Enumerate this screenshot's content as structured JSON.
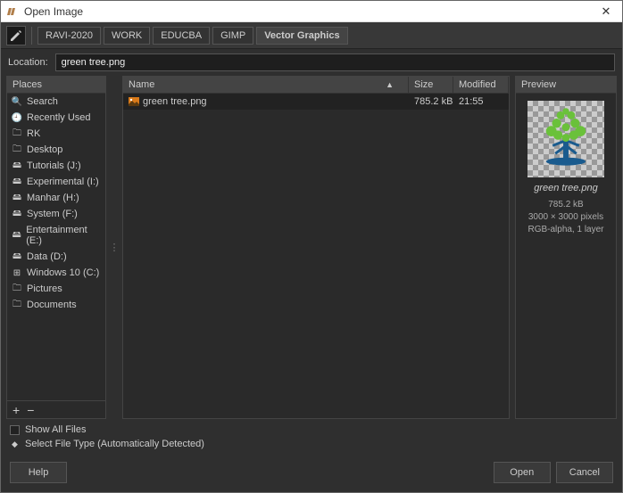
{
  "titlebar": {
    "title": "Open Image"
  },
  "breadcrumbs": [
    "RAVI-2020",
    "WORK",
    "EDUCBA",
    "GIMP",
    "Vector Graphics"
  ],
  "location": {
    "label": "Location:",
    "value": "green tree.png"
  },
  "places": {
    "header": "Places",
    "items": [
      {
        "icon": "search-icon",
        "label": "Search"
      },
      {
        "icon": "clock-icon",
        "label": "Recently Used"
      },
      {
        "icon": "folder-icon",
        "label": "RK"
      },
      {
        "icon": "folder-icon",
        "label": "Desktop"
      },
      {
        "icon": "drive-icon",
        "label": "Tutorials (J:)"
      },
      {
        "icon": "drive-icon",
        "label": "Experimental (I:)"
      },
      {
        "icon": "drive-icon",
        "label": "Manhar (H:)"
      },
      {
        "icon": "drive-icon",
        "label": "System (F:)"
      },
      {
        "icon": "drive-icon",
        "label": "Entertainment (E:)"
      },
      {
        "icon": "drive-icon",
        "label": "Data (D:)"
      },
      {
        "icon": "win-icon",
        "label": "Windows 10 (C:)"
      },
      {
        "icon": "folder-icon",
        "label": "Pictures"
      },
      {
        "icon": "folder-icon",
        "label": "Documents"
      }
    ]
  },
  "filelist": {
    "cols": {
      "name": "Name",
      "size": "Size",
      "modified": "Modified"
    },
    "rows": [
      {
        "name": "green tree.png",
        "size": "785.2 kB",
        "modified": "21:55",
        "selected": true
      }
    ]
  },
  "preview": {
    "header": "Preview",
    "name": "green tree.png",
    "size": "785.2 kB",
    "dims": "3000 × 3000 pixels",
    "mode": "RGB-alpha, 1 layer"
  },
  "options": {
    "show_all": "Show All Files",
    "filetype": "Select File Type (Automatically Detected)"
  },
  "buttons": {
    "help": "Help",
    "open": "Open",
    "cancel": "Cancel"
  }
}
